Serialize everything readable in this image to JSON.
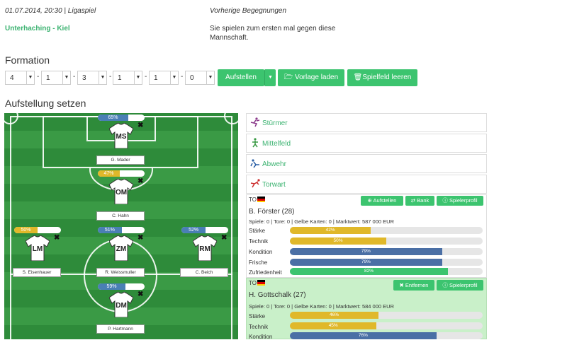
{
  "match": {
    "datetime": "01.07.2014, 20:30 | Ligaspiel",
    "teams": "Unterhaching - Kiel"
  },
  "previous": {
    "title": "Vorherige Begegnungen",
    "text_line1": "Sie spielen zum ersten mal gegen diese",
    "text_line2": "Mannschaft."
  },
  "formation": {
    "heading": "Formation",
    "values": [
      "4",
      "1",
      "3",
      "1",
      "1",
      "0"
    ],
    "separator": "-",
    "buttons": {
      "aufstellen": "Aufstellen",
      "vorlage": "Vorlage laden",
      "leeren": "Spielfeld leeren"
    }
  },
  "lineup": {
    "heading": "Aufstellung setzen",
    "players": [
      {
        "pos": "MS",
        "name": "G. Mader",
        "pct_label": "65%",
        "fitness": 0.65,
        "color": "#4a7fb5"
      },
      {
        "pos": "OM",
        "name": "C. Hahn",
        "pct_label": "47%",
        "fitness": 0.47,
        "color": "#e0b82a"
      },
      {
        "pos": "LM",
        "name": "S. Eisenhauer",
        "pct_label": "50%",
        "fitness": 0.5,
        "color": "#e0b82a"
      },
      {
        "pos": "ZM",
        "name": "R. Weissmuller",
        "pct_label": "51%",
        "fitness": 0.51,
        "color": "#4a7fb5"
      },
      {
        "pos": "RM",
        "name": "C. Beich",
        "pct_label": "52%",
        "fitness": 0.52,
        "color": "#4a7fb5"
      },
      {
        "pos": "DM",
        "name": "P. Hartmann",
        "pct_label": "59%",
        "fitness": 0.59,
        "color": "#4a7fb5"
      }
    ],
    "x_mark": "✖"
  },
  "categories": [
    {
      "label": "Stürmer"
    },
    {
      "label": "Mittelfeld"
    },
    {
      "label": "Abwehr"
    },
    {
      "label": "Torwart"
    }
  ],
  "candidates": [
    {
      "position_tag": "TO",
      "name": "B. Förster (28)",
      "info": "Spiele: 0 | Tore: 0 | Gelbe Karten: 0 | Marktwert: 587 000 EUR",
      "buttons": {
        "aufstellen": "Aufstellen",
        "bank": "Bank",
        "profil": "Spielerprofil"
      },
      "stats": [
        {
          "label": "Stärke",
          "pct_label": "42%",
          "value": 0.42,
          "color": "#e0b82a"
        },
        {
          "label": "Technik",
          "pct_label": "50%",
          "value": 0.5,
          "color": "#e0b82a"
        },
        {
          "label": "Kondition",
          "pct_label": "79%",
          "value": 0.79,
          "color": "#4a6fa5"
        },
        {
          "label": "Frische",
          "pct_label": "79%",
          "value": 0.79,
          "color": "#4a6fa5"
        },
        {
          "label": "Zufriedenheit",
          "pct_label": "82%",
          "value": 0.82,
          "color": "#3cc46f"
        }
      ]
    },
    {
      "position_tag": "TO",
      "name": "H. Gottschalk (27)",
      "info": "Spiele: 0 | Tore: 0 | Gelbe Karten: 0 | Marktwert: 584 000 EUR",
      "buttons": {
        "entfernen": "Entfernen",
        "profil": "Spielerprofil"
      },
      "stats": [
        {
          "label": "Stärke",
          "pct_label": "46%",
          "value": 0.46,
          "color": "#e0b82a"
        },
        {
          "label": "Technik",
          "pct_label": "45%",
          "value": 0.45,
          "color": "#e0b82a"
        },
        {
          "label": "Kondition",
          "pct_label": "76%",
          "value": 0.76,
          "color": "#4a6fa5"
        }
      ]
    }
  ]
}
